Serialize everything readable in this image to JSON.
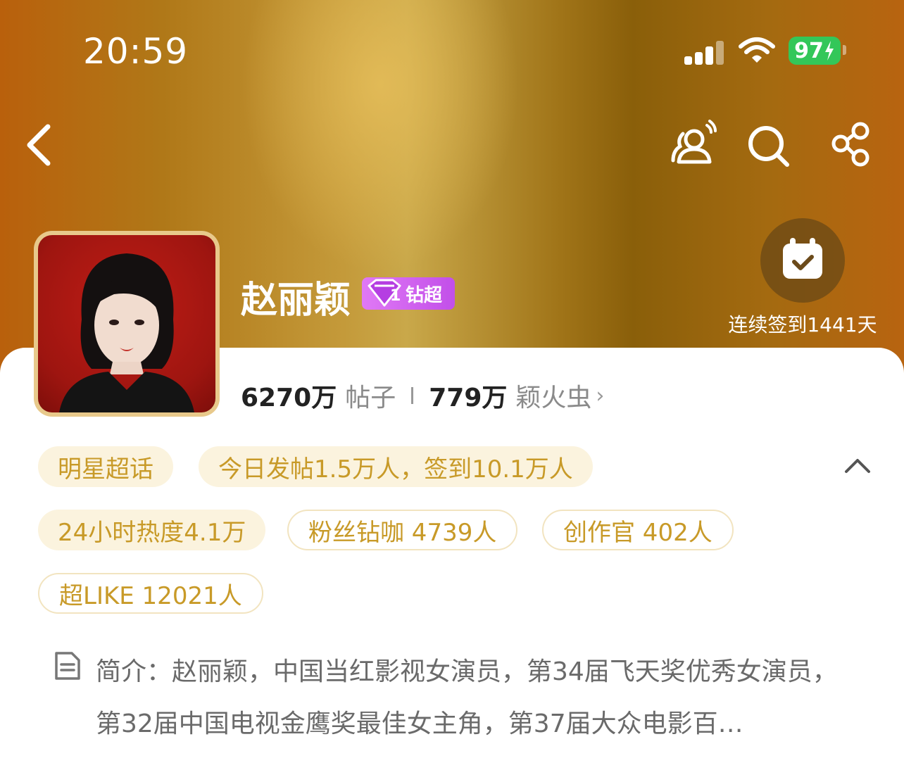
{
  "status_bar": {
    "time": "20:59",
    "battery": "97"
  },
  "topic": {
    "name": "赵丽颖",
    "badge_level": "1",
    "badge_label": "钻超",
    "checkin_label": "连续签到1441天",
    "posts_count": "6270万",
    "posts_label": "帖子",
    "fans_count": "779万",
    "fans_label": "颖火虫"
  },
  "chips": {
    "category": "明星超话",
    "today": "今日发帖1.5万人，签到10.1万人",
    "heat": "24小时热度4.1万",
    "fans_vip": "粉丝钻咖 4739人",
    "creators": "创作官 402人",
    "superlike": "超LIKE 12021人"
  },
  "intro": {
    "text": "简介：赵丽颖，中国当红影视女演员，第34届飞天奖优秀女演员，第32届中国电视金鹰奖最佳女主角，第37届大众电影百…"
  },
  "colors": {
    "accent": "#c89a28",
    "chip_bg": "#fbf3de",
    "badge": "#d065ef",
    "battery": "#33c759"
  }
}
